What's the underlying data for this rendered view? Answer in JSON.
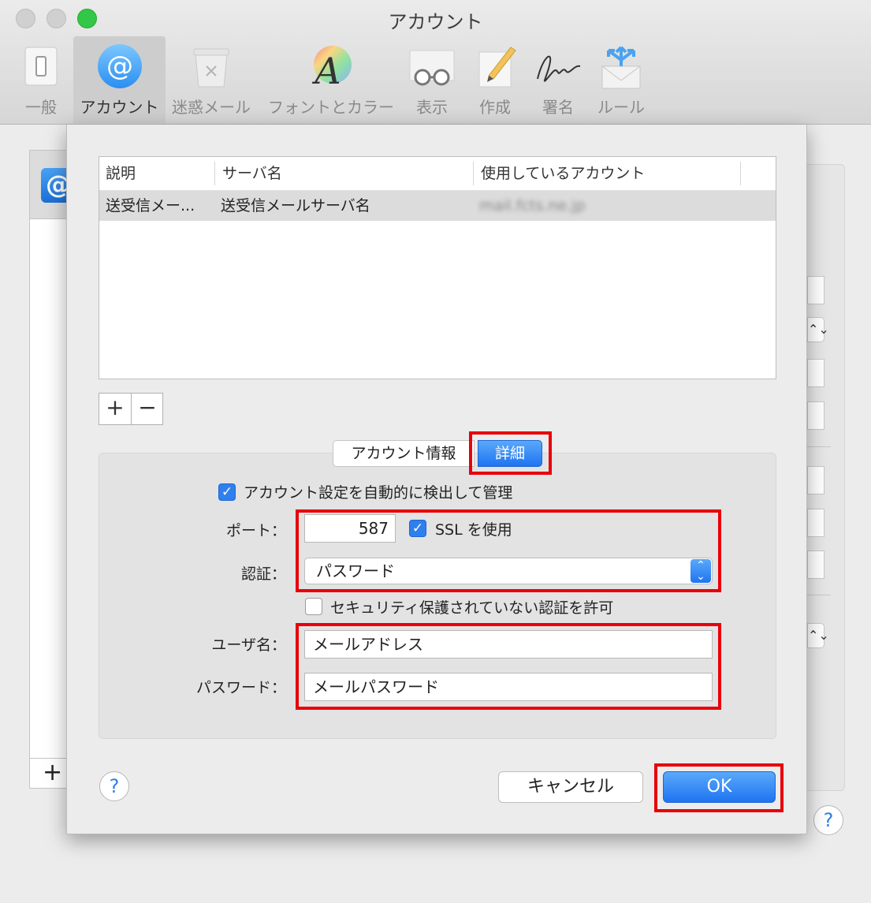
{
  "window": {
    "title": "アカウント"
  },
  "toolbar": {
    "items": [
      {
        "label": "一般",
        "icon": "general-switch-icon"
      },
      {
        "label": "アカウント",
        "icon": "at-sign-icon"
      },
      {
        "label": "迷惑メール",
        "icon": "junk-bin-icon"
      },
      {
        "label": "フォントとカラー",
        "icon": "font-color-icon"
      },
      {
        "label": "表示",
        "icon": "glasses-icon"
      },
      {
        "label": "作成",
        "icon": "pencil-icon"
      },
      {
        "label": "署名",
        "icon": "signature-icon"
      },
      {
        "label": "ルール",
        "icon": "rules-envelope-icon"
      }
    ],
    "active_index": 1
  },
  "background": {
    "sidebar_icon": "@",
    "add_label": "+",
    "help": "?",
    "stepper": "⌃⌄"
  },
  "server_table": {
    "columns": [
      "説明",
      "サーバ名",
      "使用しているアカウント"
    ],
    "rows": [
      {
        "description": "送受信メー...",
        "server": "送受信メールサーバ名",
        "account": "mail.fcts.ne.jp"
      }
    ]
  },
  "add_remove": {
    "add": "+",
    "remove": "−"
  },
  "tabs": {
    "info": "アカウント情報",
    "detail": "詳細"
  },
  "details": {
    "auto_manage_label": "アカウント設定を自動的に検出して管理",
    "auto_manage_checked": true,
    "port_label": "ポート：",
    "port_value": "587",
    "ssl_label": "SSL を使用",
    "ssl_checked": true,
    "auth_label": "認証：",
    "auth_value": "パスワード",
    "insecure_label": "セキュリティ保護されていない認証を許可",
    "insecure_checked": false,
    "username_label": "ユーザ名：",
    "username_value": "メールアドレス",
    "password_label": "パスワード：",
    "password_value": "メールパスワード"
  },
  "footer": {
    "help": "?",
    "cancel": "キャンセル",
    "ok": "OK"
  },
  "colors": {
    "accent": "#2f80ed",
    "highlight_box": "#e8000b",
    "traffic_green": "#33c748"
  }
}
